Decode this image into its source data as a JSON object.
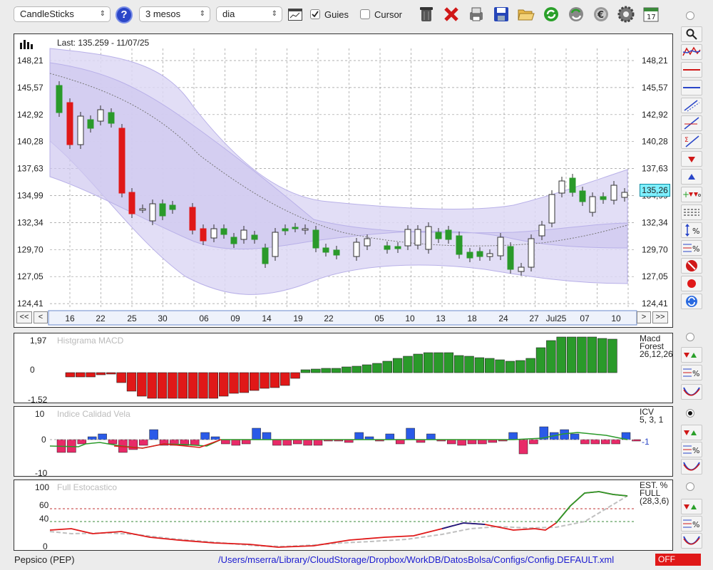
{
  "toolbar": {
    "chart_type": "CandleSticks",
    "help_label": "?",
    "period": "3 mesos",
    "interval": "dia",
    "guides_label": "Guies",
    "guides_checked": true,
    "cursor_label": "Cursor",
    "cursor_checked": false,
    "calendar_day": "17"
  },
  "price_panel": {
    "last_label": "Last: 135.259 - 11/07/25",
    "current_price_tag": "135,26",
    "y_ticks": [
      "148,21",
      "145,57",
      "142,92",
      "140,28",
      "137,63",
      "134,99",
      "132,34",
      "129,70",
      "127,05",
      "124,41"
    ],
    "x_ticks": [
      "16",
      "22",
      "25",
      "30",
      "06",
      "09",
      "14",
      "19",
      "22",
      "05",
      "10",
      "13",
      "18",
      "24",
      "27",
      "Jul25",
      "07",
      "10"
    ],
    "nav": {
      "first": "<<",
      "prev": "<",
      "next": ">",
      "last": ">>"
    }
  },
  "macd_panel": {
    "title": "Histgrama MACD",
    "label_line1": "Macd",
    "label_line2": "Forest",
    "label_line3": "26,12,26",
    "y_ticks": [
      "1,97",
      "0",
      "-1,52"
    ]
  },
  "icv_panel": {
    "title": "Indice Calidad Vela",
    "label_line1": "ICV",
    "label_line2": "5, 3, 1",
    "value": "-1",
    "y_ticks": [
      "10",
      "0",
      "-10"
    ]
  },
  "stoch_panel": {
    "title": "Full Estocastico",
    "label_line1": "EST. %",
    "label_line2": "FULL",
    "label_line3": "(28,3,6)",
    "y_ticks": [
      "100",
      "60",
      "40",
      "0"
    ]
  },
  "status": {
    "company": "Pepsico (PEP)",
    "path": "/Users/mserra/Library/CloudStorage/Dropbox/WorkDB/DatosBolsa/Configs/Config.DEFAULT.xml",
    "state": "OFF"
  },
  "colors": {
    "bull": "#2a9a2a",
    "bear": "#e01818",
    "link": "#1a1ad0",
    "band": "#ddd8f5"
  }
}
